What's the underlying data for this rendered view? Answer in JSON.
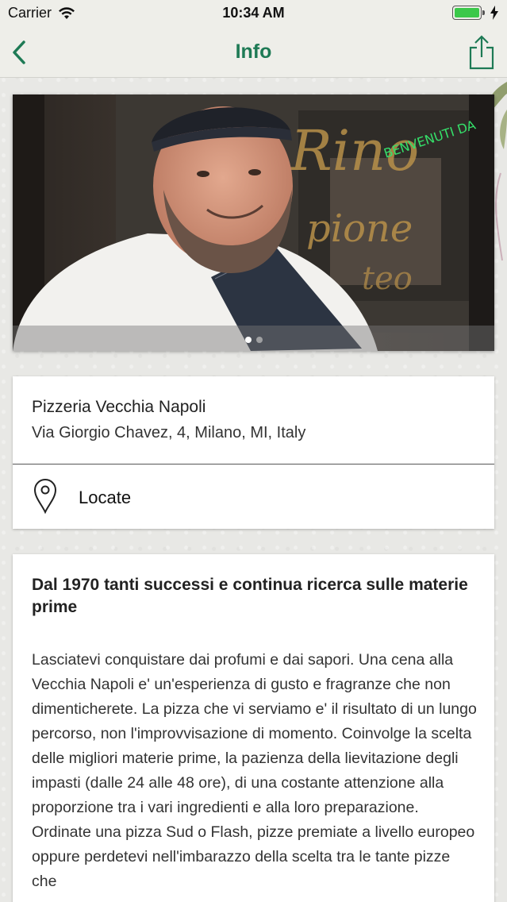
{
  "status_bar": {
    "carrier": "Carrier",
    "time": "10:34 AM",
    "battery_level": 1.0,
    "wifi_icon": "wifi-icon",
    "charging_icon": "bolt-icon"
  },
  "nav": {
    "title": "Info",
    "back_icon": "chevron-left-icon",
    "share_icon": "share-icon",
    "accent_color": "#1e7a55"
  },
  "gallery": {
    "slide_count": 2,
    "active_index": 0
  },
  "place": {
    "name": "Pizzeria Vecchia Napoli",
    "address": "Via Giorgio Chavez, 4, Milano, MI, Italy",
    "locate_label": "Locate",
    "locate_icon": "map-pin-icon"
  },
  "description": {
    "title": "Dal 1970 tanti successi e continua ricerca sulle materie prime",
    "body": "Lasciatevi conquistare dai profumi e dai sapori. Una cena alla Vecchia Napoli e' un'esperienza di gusto e fragranze che non dimenticherete. La pizza che vi serviamo e' il risultato di un lungo percorso, non l'improvvisazione di momento. Coinvolge la scelta delle migliori materie prime, la pazienza della lievitazione degli impasti (dalle 24 alle 48 ore), di una costante attenzione alla proporzione tra i vari ingredienti e alla loro preparazione. Ordinate una pizza Sud o Flash, pizze premiate a livello europeo oppure perdetevi nell'imbarazzo della scelta tra le tante pizze che"
  }
}
